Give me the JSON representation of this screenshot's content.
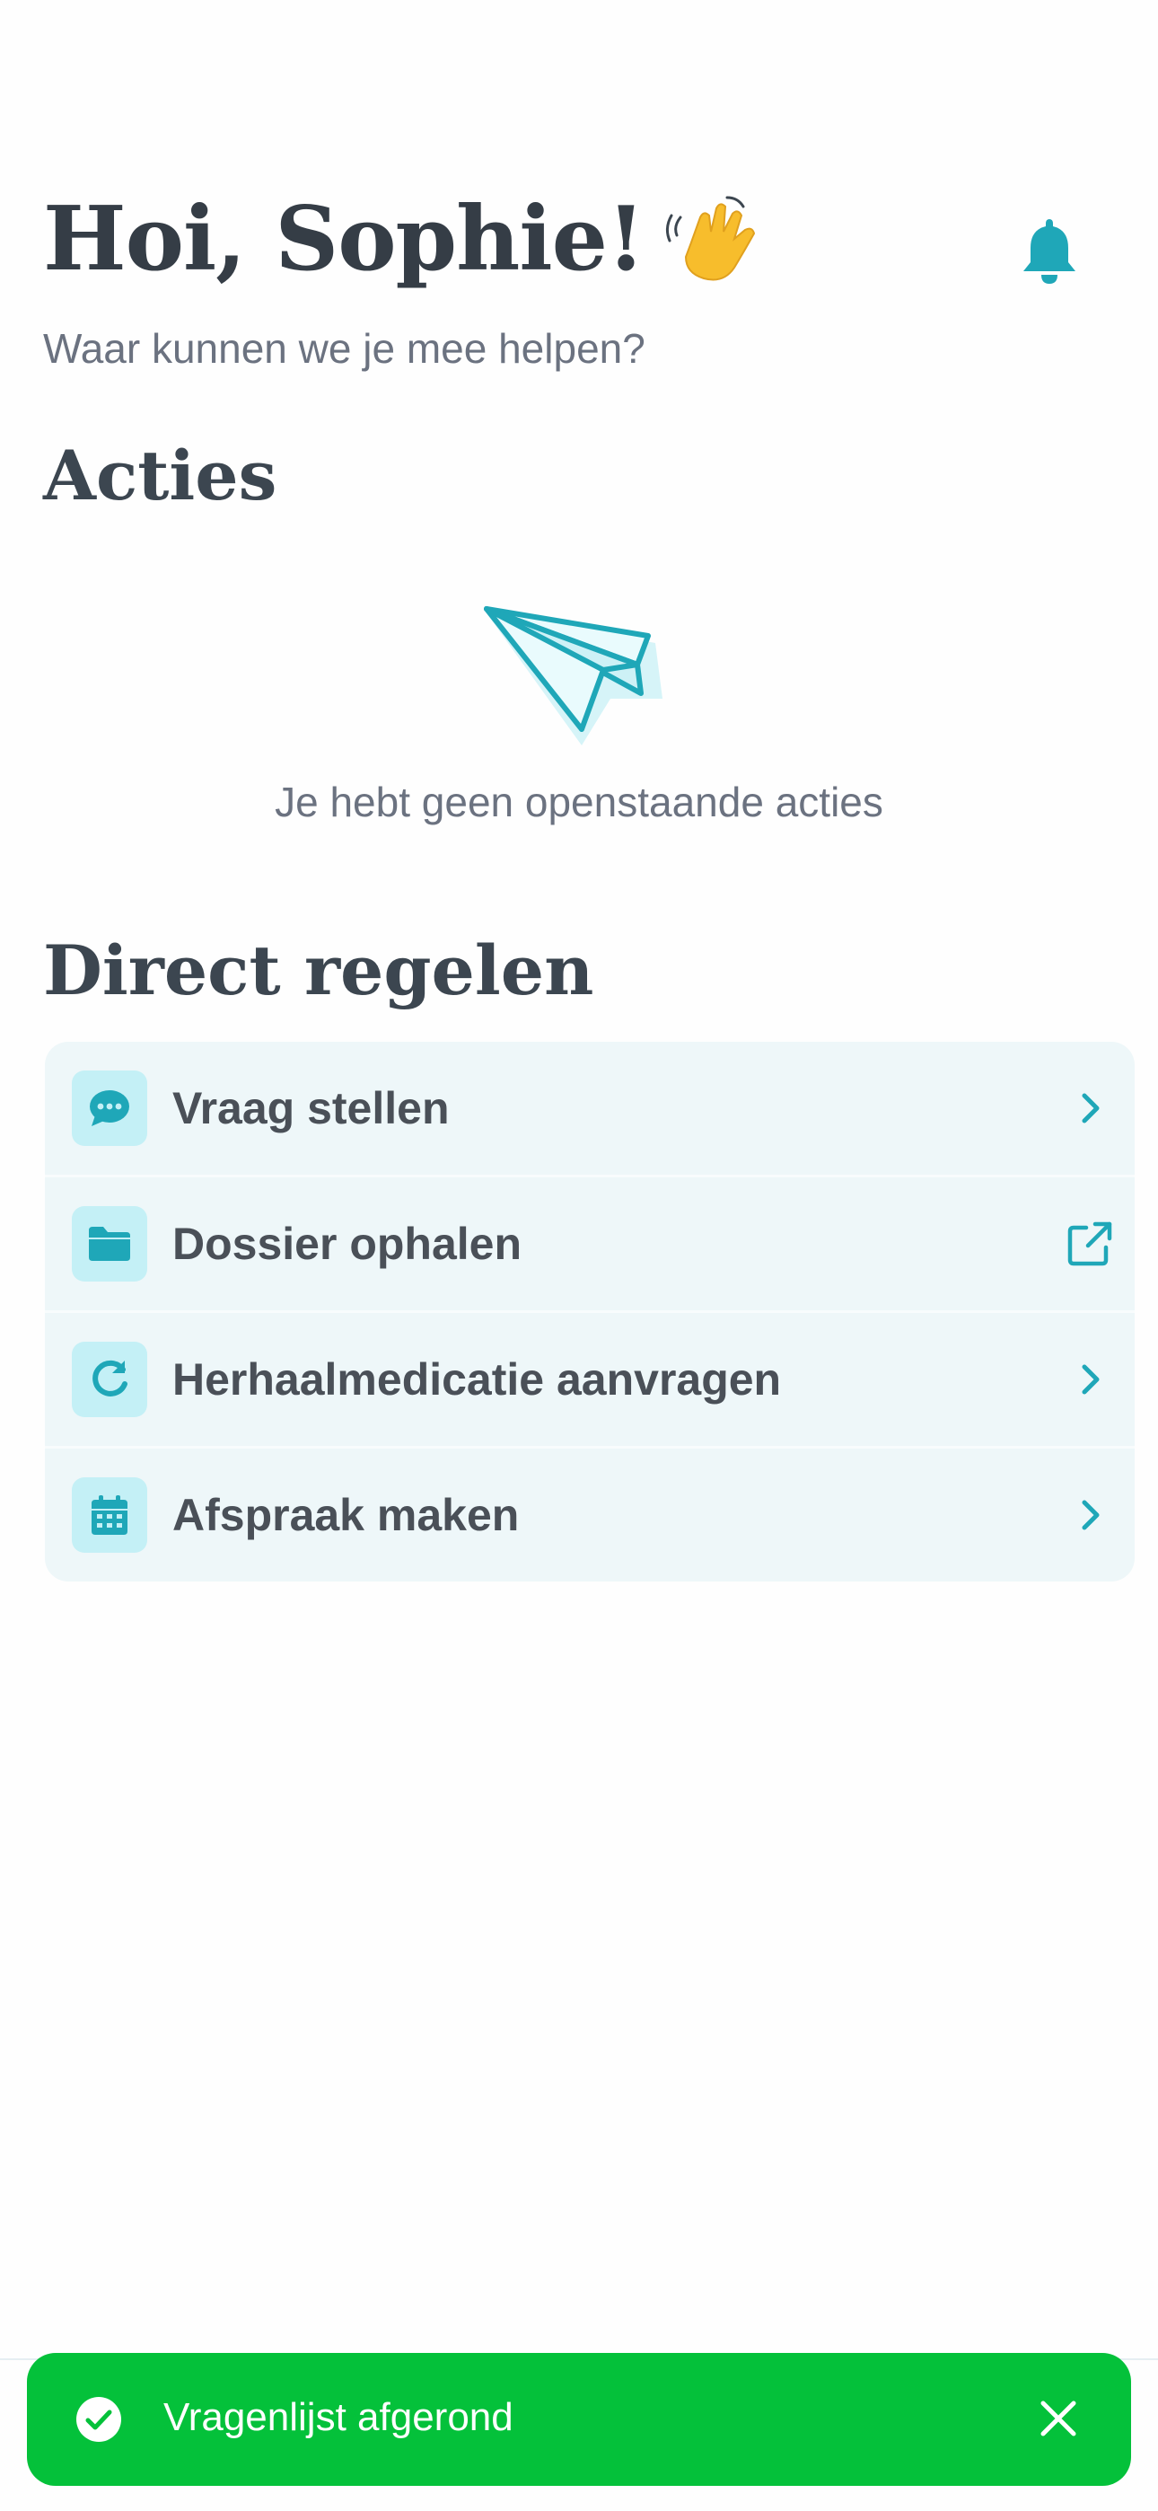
{
  "header": {
    "greeting": "Hoi, Sophie!",
    "subtitle": "Waar kunnen we je mee helpen?"
  },
  "actions": {
    "title": "Acties",
    "empty_text": "Je hebt geen openstaande acties"
  },
  "direct": {
    "title": "Direct regelen",
    "items": [
      {
        "label": "Vraag stellen",
        "icon": "chat-bubble-icon",
        "trailing": "chevron-right-icon"
      },
      {
        "label": "Dossier ophalen",
        "icon": "folder-icon",
        "trailing": "external-link-icon"
      },
      {
        "label": "Herhaalmedicatie aanvragen",
        "icon": "refresh-icon",
        "trailing": "chevron-right-icon"
      },
      {
        "label": "Afspraak maken",
        "icon": "calendar-icon",
        "trailing": "chevron-right-icon"
      }
    ]
  },
  "toast": {
    "text": "Vragenlijst afgerond",
    "color": "#04c13a"
  },
  "colors": {
    "accent": "#1fa7b8",
    "heading": "#353d46",
    "list_background": "#eef7f9",
    "icon_tile": "#c4f0f6"
  }
}
